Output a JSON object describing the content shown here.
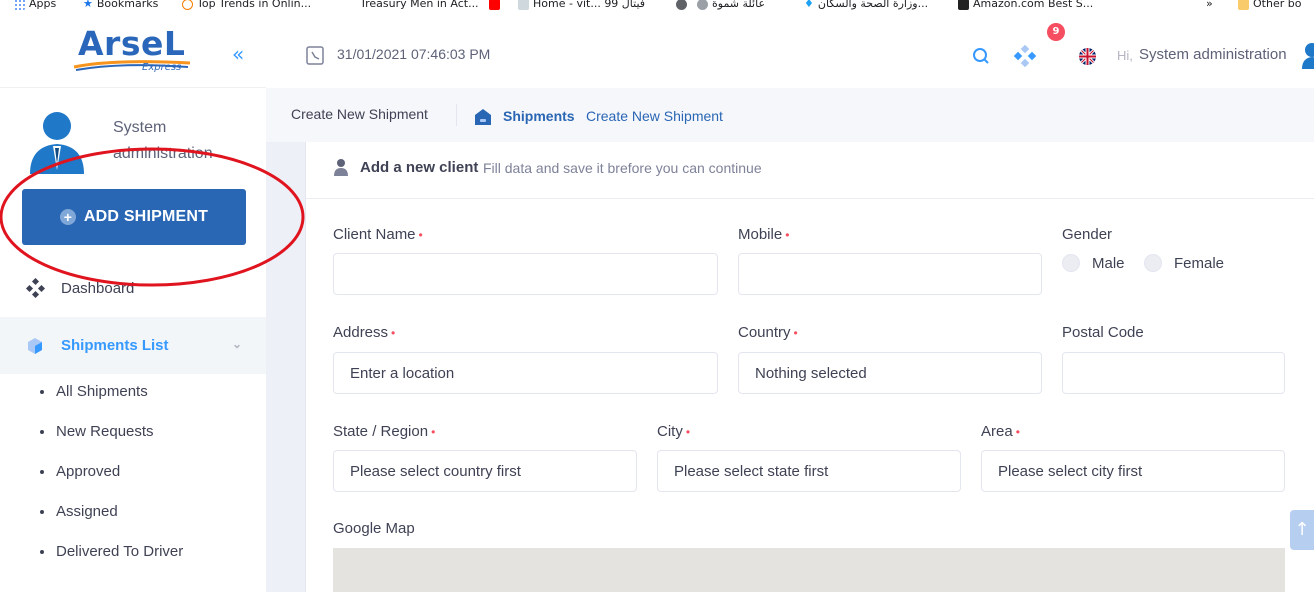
{
  "bookmarks": [
    {
      "label": "Apps",
      "icon": "apps-grid-icon"
    },
    {
      "label": "Bookmarks",
      "icon": "star-icon"
    },
    {
      "label": "Top Trends in Onlin...",
      "icon": "trends-icon"
    },
    {
      "label": "Treasury Men in Act...",
      "icon": "page-icon"
    },
    {
      "label": "Home - vit... فيتال 99",
      "icon": "youtube-icon"
    },
    {
      "label": "عائلة شموة",
      "icon": "globe-icon"
    },
    {
      "label": "وزارة الصحة والسكان...",
      "icon": "twitter-icon"
    },
    {
      "label": "Amazon.com Best S...",
      "icon": "amazon-icon"
    },
    {
      "label": "»",
      "icon": ""
    },
    {
      "label": "Other bo",
      "icon": "folder-icon"
    }
  ],
  "brand": {
    "name": "ArseL",
    "tagline": "Express",
    "collapse": "«"
  },
  "user": {
    "name": "System administration"
  },
  "add_shipment": {
    "label": "ADD SHIPMENT",
    "plus": "+"
  },
  "nav": {
    "dashboard": "Dashboard",
    "shipments_list": "Shipments List",
    "chevron": "⌄",
    "sub_items": [
      "All Shipments",
      "New Requests",
      "Approved",
      "Assigned",
      "Delivered To Driver"
    ]
  },
  "header": {
    "datetime": "31/01/2021 07:46:03 PM",
    "notifications": "9",
    "hi": "Hi,",
    "user": "System administration"
  },
  "subheader": {
    "title": "Create New Shipment",
    "crumb_1": "Shipments",
    "crumb_2": "Create New Shipment"
  },
  "card": {
    "title": "Add a new client",
    "hint": "Fill data and save it brefore you can continue"
  },
  "form": {
    "client_name": {
      "label": "Client Name",
      "value": ""
    },
    "mobile": {
      "label": "Mobile",
      "value": ""
    },
    "gender": {
      "label": "Gender",
      "options": [
        "Male",
        "Female"
      ]
    },
    "address": {
      "label": "Address",
      "placeholder": "Enter a location"
    },
    "country": {
      "label": "Country",
      "value": "Nothing selected"
    },
    "postal_code": {
      "label": "Postal Code",
      "value": ""
    },
    "state": {
      "label": "State / Region",
      "value": "Please select country first"
    },
    "city": {
      "label": "City",
      "value": "Please select state first"
    },
    "area": {
      "label": "Area",
      "value": "Please select city first"
    },
    "google_map": {
      "label": "Google Map"
    },
    "required_mark": "•"
  },
  "scroll_top": "↑",
  "colors": {
    "primary": "#2966b4",
    "accent": "#3699ff",
    "badge": "#f64e60",
    "annotation": "#e0141e"
  }
}
